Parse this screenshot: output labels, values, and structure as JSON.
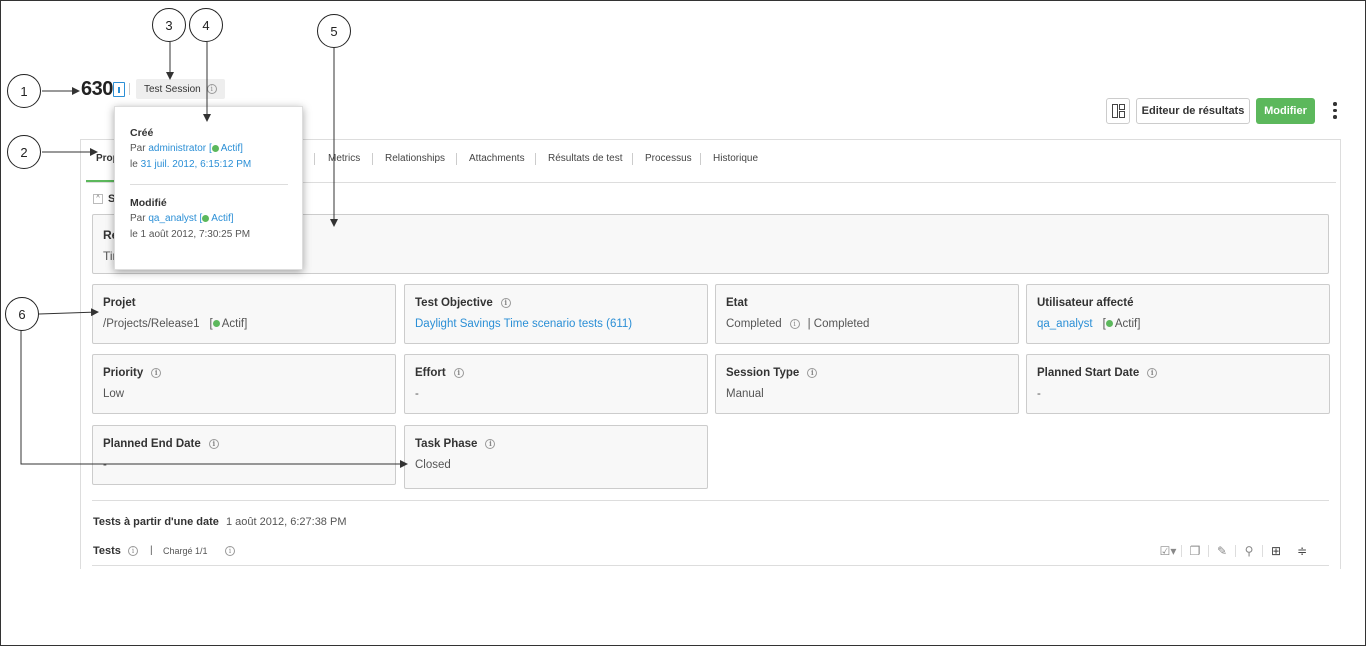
{
  "callouts": [
    "1",
    "2",
    "3",
    "4",
    "5",
    "6"
  ],
  "header": {
    "id": "630",
    "type_badge": "Test Session",
    "editor_button": "Editeur de résultats",
    "modify_button": "Modifier"
  },
  "tabs": [
    "Prop",
    "Metrics",
    "Relationships",
    "Attachments",
    "Résultats de test",
    "Processus",
    "Historique"
  ],
  "section": {
    "title": "S"
  },
  "summary": {
    "label": "Ré",
    "value": "Tir"
  },
  "popover": {
    "created_heading": "Créé",
    "created_by_prefix": "Par",
    "created_by_user": "administrator",
    "created_status": "Actif",
    "created_on_prefix": "le",
    "created_on_date": "31 juil. 2012, 6:15:12 PM",
    "modified_heading": "Modifié",
    "modified_by_prefix": "Par",
    "modified_by_user": "qa_analyst",
    "modified_status": "Actif",
    "modified_on": "le 1 août 2012, 7:30:25 PM"
  },
  "fields": {
    "projet": {
      "label": "Projet",
      "value": "/Projects/Release1",
      "status": "Actif"
    },
    "test_objective": {
      "label": "Test Objective",
      "value": "Daylight Savings Time scenario tests (611)"
    },
    "etat": {
      "label": "Etat",
      "value": "Completed",
      "value2": "| Completed"
    },
    "utilisateur": {
      "label": "Utilisateur affecté",
      "value": "qa_analyst",
      "status": "Actif"
    },
    "priority": {
      "label": "Priority",
      "value": "Low"
    },
    "effort": {
      "label": "Effort",
      "value": "-"
    },
    "session_type": {
      "label": "Session Type",
      "value": "Manual"
    },
    "planned_start": {
      "label": "Planned Start Date",
      "value": "-"
    },
    "planned_end": {
      "label": "Planned End Date",
      "value": "-"
    },
    "task_phase": {
      "label": "Task Phase",
      "value": "Closed"
    }
  },
  "tests_section": {
    "date_label": "Tests à partir d'une date",
    "date_value": "1 août 2012, 6:27:38 PM",
    "tests_label": "Tests",
    "loaded": "Chargé 1/1"
  },
  "colors": {
    "accent_green": "#5cb85c",
    "link_blue": "#2b8fd6"
  }
}
